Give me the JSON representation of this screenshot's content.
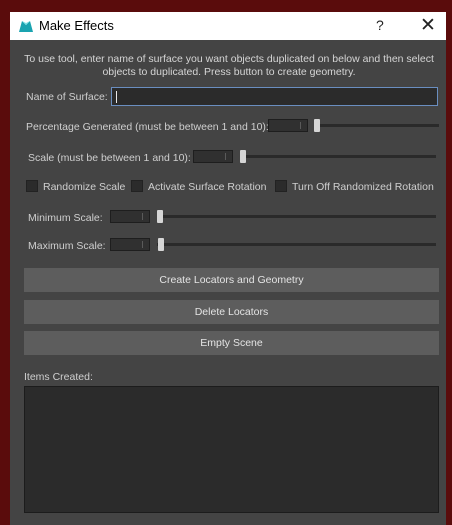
{
  "window": {
    "title": "Make Effects",
    "help_glyph": "?",
    "close_glyph": "✕",
    "app_icon": "maya-icon"
  },
  "instructions": "To use tool, enter name of surface you want objects duplicated on below and then select objects to duplicated. Press button to create geometry.",
  "surface": {
    "label": "Name of Surface:",
    "value": ""
  },
  "percentage": {
    "label": "Percentage Generated (must be between 1 and 10):",
    "level": 0.04
  },
  "scale": {
    "label": "Scale (must be between 1 and 10):",
    "level": 0.02
  },
  "checkboxes": [
    {
      "label": "Randomize Scale",
      "checked": false
    },
    {
      "label": "Activate Surface Rotation",
      "checked": false
    },
    {
      "label": "Turn Off Randomized Rotation",
      "checked": false
    }
  ],
  "min_scale": {
    "label": "Minimum Scale:",
    "level": 0.01
  },
  "max_scale": {
    "label": "Maximum Scale:",
    "level": 0.01
  },
  "buttons": {
    "create": "Create Locators and Geometry",
    "delete": "Delete Locators",
    "empty": "Empty Scene"
  },
  "items_created": {
    "label": "Items Created:",
    "items": []
  }
}
